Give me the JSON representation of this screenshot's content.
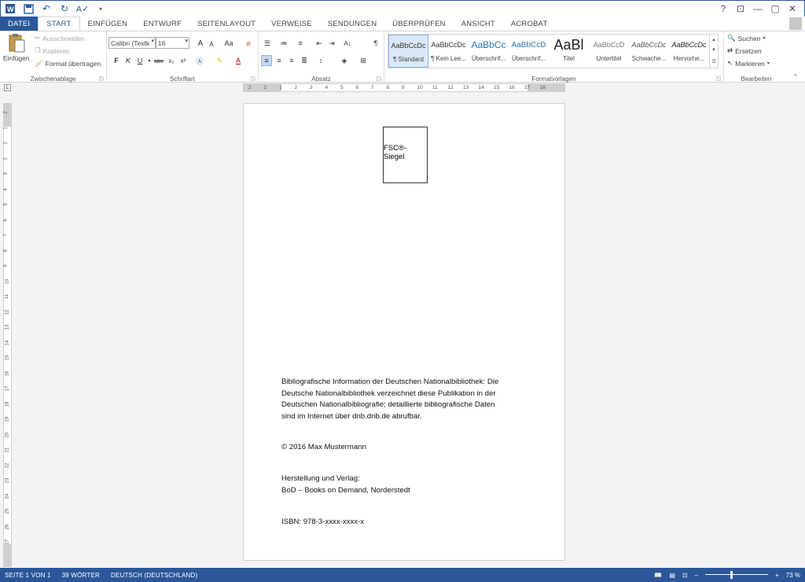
{
  "colors": {
    "accent": "#2b579a",
    "ribbon_bg": "#ffffff",
    "workspace_bg": "#f3f3f3"
  },
  "quick_access": [
    "word-icon",
    "save-icon",
    "undo-icon",
    "redo-icon",
    "spelling-icon",
    "customize-icon"
  ],
  "window_controls": {
    "help": "?",
    "ribbon_display": "⊡",
    "minimize": "—",
    "restore": "▢",
    "close": "✕"
  },
  "tabs": [
    "DATEI",
    "START",
    "EINFÜGEN",
    "ENTWURF",
    "SEITENLAYOUT",
    "VERWEISE",
    "SENDUNGEN",
    "ÜBERPRÜFEN",
    "ANSICHT",
    "ACROBAT"
  ],
  "ribbon": {
    "clipboard": {
      "paste": "Einfügen",
      "cut": "Ausschneiden",
      "copy": "Kopieren",
      "format_painter": "Format übertragen",
      "label": "Zwischenablage"
    },
    "font": {
      "font_name": "Calibri (Textk",
      "font_size": "16",
      "bold": "F",
      "italic": "K",
      "underline": "U",
      "strike": "abc",
      "subscript": "x₂",
      "superscript": "x²",
      "grow": "A",
      "shrink": "A",
      "case": "Aa",
      "label": "Schriftart"
    },
    "paragraph": {
      "label": "Absatz",
      "pilcrow": "¶"
    },
    "styles": {
      "items": [
        {
          "preview": "AaBbCcDc",
          "name": "¶ Standard"
        },
        {
          "preview": "AaBbCcDc",
          "name": "¶ Kein Lee..."
        },
        {
          "preview": "AaBbCc",
          "name": "Überschrif..."
        },
        {
          "preview": "AaBbCcD",
          "name": "Überschrif..."
        },
        {
          "preview": "AaBl",
          "name": "Titel"
        },
        {
          "preview": "AaBbCcD",
          "name": "Untertitel"
        },
        {
          "preview": "AaBbCcDc",
          "name": "Schwache..."
        },
        {
          "preview": "AaBbCcDc",
          "name": "Hervorhe..."
        }
      ],
      "label": "Formatvorlagen"
    },
    "editing": {
      "find": "Suchen",
      "replace": "Ersetzen",
      "select": "Markieren",
      "label": "Bearbeiten"
    }
  },
  "ruler": {
    "h_ticks": [
      "2",
      "1",
      "1",
      "2",
      "3",
      "4",
      "5",
      "6",
      "7",
      "8",
      "9",
      "10",
      "11",
      "12",
      "13",
      "14",
      "15",
      "16",
      "17",
      "18"
    ],
    "v_ticks": [
      "2",
      "1",
      "1",
      "2",
      "3",
      "4",
      "5",
      "6",
      "7",
      "8",
      "9",
      "10",
      "11",
      "12",
      "13",
      "14",
      "15",
      "16",
      "17",
      "18",
      "19",
      "20",
      "21",
      "22",
      "23",
      "24",
      "25",
      "26",
      "27"
    ],
    "tab_selector": "L"
  },
  "document": {
    "seal": "FSC®-Siegel",
    "biblio_lines": [
      "Bibliografische Information der Deutschen Nationalbibliothek: Die",
      "Deutsche Nationalbibliothek verzeichnet diese Publikation in der",
      "Deutschen Nationalbibliografie; detaillierte bibliografische Daten",
      "sind im Internet über dnb.dnb.de abrufbar."
    ],
    "copyright": "© 2016 Max Mustermann",
    "publisher_lines": [
      "Herstellung und Verlag:",
      "BoD – Books on Demand, Norderstedt"
    ],
    "isbn": "ISBN: 978-3-xxxx-xxxx-x"
  },
  "statusbar": {
    "page": "SEITE 1 VON 1",
    "words": "39 WÖRTER",
    "language": "DEUTSCH (DEUTSCHLAND)",
    "zoom_minus": "–",
    "zoom_plus": "+",
    "zoom": "73 %",
    "zoom_fraction": 0.42
  }
}
